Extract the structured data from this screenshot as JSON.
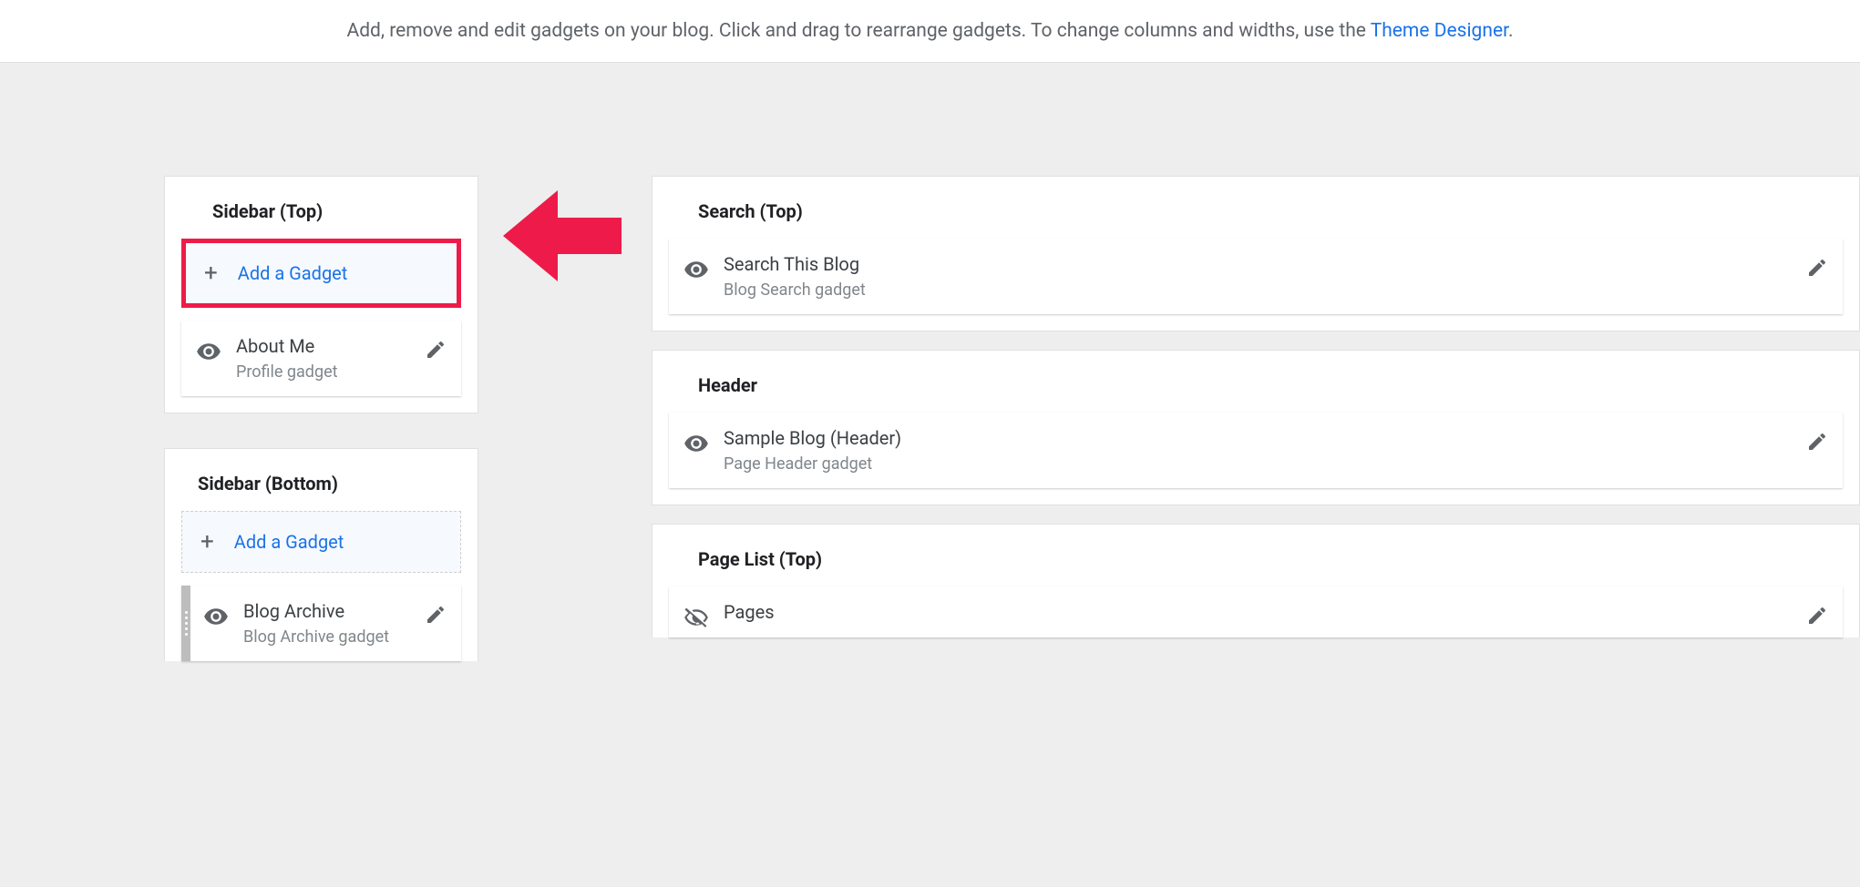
{
  "topBar": {
    "text_before": "Add, remove and edit gadgets on your blog. Click and drag to rearrange gadgets. To change columns and widths, use the ",
    "link_text": "Theme Designer",
    "text_after": "."
  },
  "sidebarTop": {
    "title": "Sidebar (Top)",
    "addLabel": "Add a Gadget",
    "gadget": {
      "title": "About Me",
      "subtitle": "Profile gadget"
    }
  },
  "sidebarBottom": {
    "title": "Sidebar (Bottom)",
    "addLabel": "Add a Gadget",
    "gadget": {
      "title": "Blog Archive",
      "subtitle": "Blog Archive gadget"
    }
  },
  "searchTop": {
    "title": "Search (Top)",
    "gadget": {
      "title": "Search This Blog",
      "subtitle": "Blog Search gadget"
    }
  },
  "header": {
    "title": "Header",
    "gadget": {
      "title": "Sample Blog (Header)",
      "subtitle": "Page Header gadget"
    }
  },
  "pageList": {
    "title": "Page List (Top)",
    "gadget": {
      "title": "Pages"
    }
  }
}
